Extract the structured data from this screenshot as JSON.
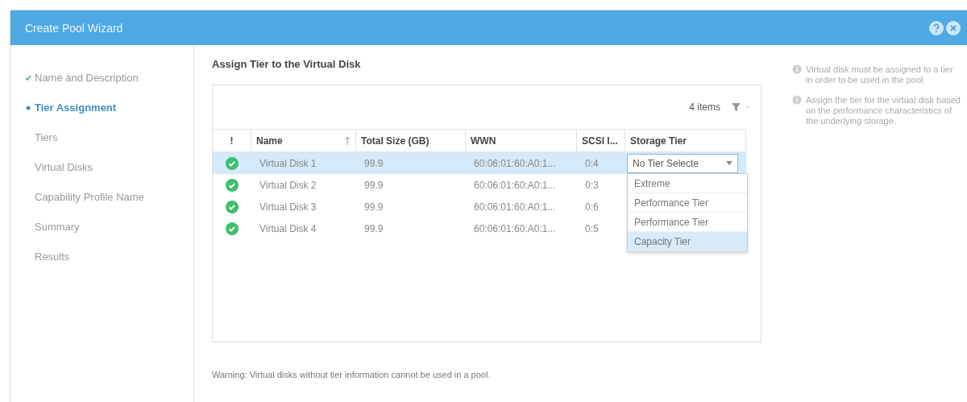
{
  "window": {
    "title": "Create Pool Wizard"
  },
  "steps": [
    {
      "label": "Name and Description",
      "done": true,
      "selected": false
    },
    {
      "label": "Tier Assignment",
      "done": false,
      "selected": true
    },
    {
      "label": "Tiers",
      "done": false,
      "selected": false
    },
    {
      "label": "Virtual Disks",
      "done": false,
      "selected": false
    },
    {
      "label": "Capability Profile Name",
      "done": false,
      "selected": false
    },
    {
      "label": "Summary",
      "done": false,
      "selected": false
    },
    {
      "label": "Results",
      "done": false,
      "selected": false
    }
  ],
  "heading": "Assign Tier to the Virtual Disk",
  "table": {
    "item_count": "4 items",
    "columns": [
      "!",
      "Name",
      "Total Size (GB)",
      "WWN",
      "SCSI I...",
      "Storage Tier"
    ],
    "rows": [
      {
        "name": "Virtual Disk 1",
        "size": "99.9",
        "wwn": "60:06:01:60:A0:1...",
        "scsi": "0:4",
        "tier": "No Tier Selecte",
        "selected": true
      },
      {
        "name": "Virtual Disk 2",
        "size": "99.9",
        "wwn": "60:06:01:60:A0:1...",
        "scsi": "0:3",
        "selected": false
      },
      {
        "name": "Virtual Disk 3",
        "size": "99.9",
        "wwn": "60:06:01:60:A0:1...",
        "scsi": "0:6",
        "selected": false
      },
      {
        "name": "Virtual Disk 4",
        "size": "99.9",
        "wwn": "60:06:01:60:A0:1...",
        "scsi": "0:5",
        "selected": false
      }
    ],
    "dropdown": [
      {
        "label": "Extreme",
        "selected": false
      },
      {
        "label": "Performance Tier",
        "selected": false
      },
      {
        "label": "Performance Tier",
        "selected": false
      },
      {
        "label": "Capacity Tier",
        "selected": true
      }
    ]
  },
  "warning": "Warning: Virtual disks without tier information cannot be used in a pool.",
  "notes": [
    "Virtual disk must be assigned to a tier in order to be used in the pool",
    "Assign the tier for the virtual disk based on the performance characteristics of the underlying storage."
  ]
}
